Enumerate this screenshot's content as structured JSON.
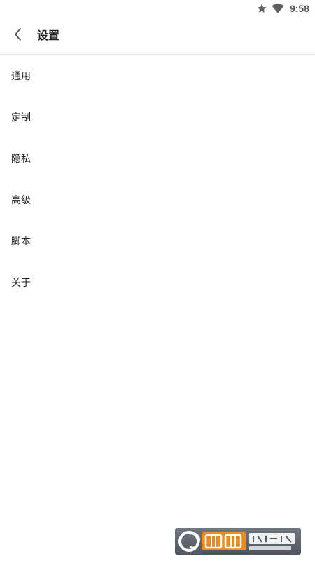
{
  "status_bar": {
    "time": "9:58",
    "icons": [
      "star-icon",
      "wifi-icon"
    ]
  },
  "header": {
    "back_icon": "chevron-left-icon",
    "title": "设置"
  },
  "settings": {
    "items": [
      {
        "label": "通用"
      },
      {
        "label": "定制"
      },
      {
        "label": "隐私"
      },
      {
        "label": "高级"
      },
      {
        "label": "脚本"
      },
      {
        "label": "关于"
      }
    ]
  },
  "watermark": {
    "brand_text": "西西软件园",
    "domain_text": "CR173.COM"
  }
}
